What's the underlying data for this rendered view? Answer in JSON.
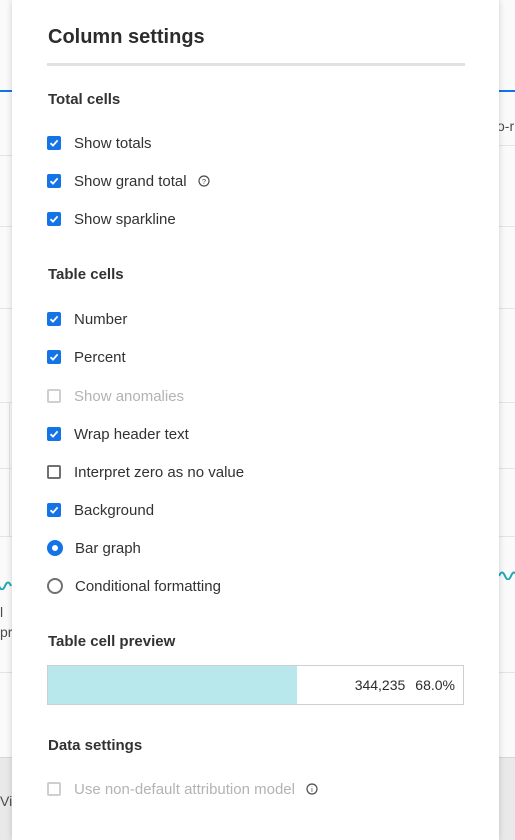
{
  "panel": {
    "title": "Column settings"
  },
  "total_cells": {
    "heading": "Total cells",
    "options": [
      {
        "label": "Show totals",
        "checked": true
      },
      {
        "label": "Show grand total",
        "checked": true,
        "info_icon": "help-icon"
      },
      {
        "label": "Show sparkline",
        "checked": true
      }
    ]
  },
  "table_cells": {
    "heading": "Table cells",
    "options": [
      {
        "label": "Number",
        "type": "checkbox",
        "checked": true
      },
      {
        "label": "Percent",
        "type": "checkbox",
        "checked": true
      },
      {
        "label": "Show anomalies",
        "type": "checkbox",
        "checked": false,
        "disabled": true
      },
      {
        "label": "Wrap header text",
        "type": "checkbox",
        "checked": true
      },
      {
        "label": "Interpret zero as no value",
        "type": "checkbox",
        "checked": false
      },
      {
        "label": "Background",
        "type": "checkbox",
        "checked": true
      },
      {
        "label": "Bar graph",
        "type": "radio",
        "selected": true
      },
      {
        "label": "Conditional formatting",
        "type": "radio",
        "selected": false
      }
    ]
  },
  "preview": {
    "heading": "Table cell preview",
    "number": "344,235",
    "percent": "68.0%",
    "bar_fill_fraction": 0.6,
    "bar_color": "#b9e8ec"
  },
  "data_settings": {
    "heading": "Data settings",
    "options": [
      {
        "label": "Use non-default attribution model",
        "checked": false,
        "disabled": true,
        "info_icon": "info-icon"
      }
    ]
  },
  "background": {
    "text_fragments": [
      "o-r",
      "l",
      "pr",
      "Vi"
    ]
  },
  "colors": {
    "accent": "#1473e6",
    "disabled_text": "#b3b3b3"
  }
}
